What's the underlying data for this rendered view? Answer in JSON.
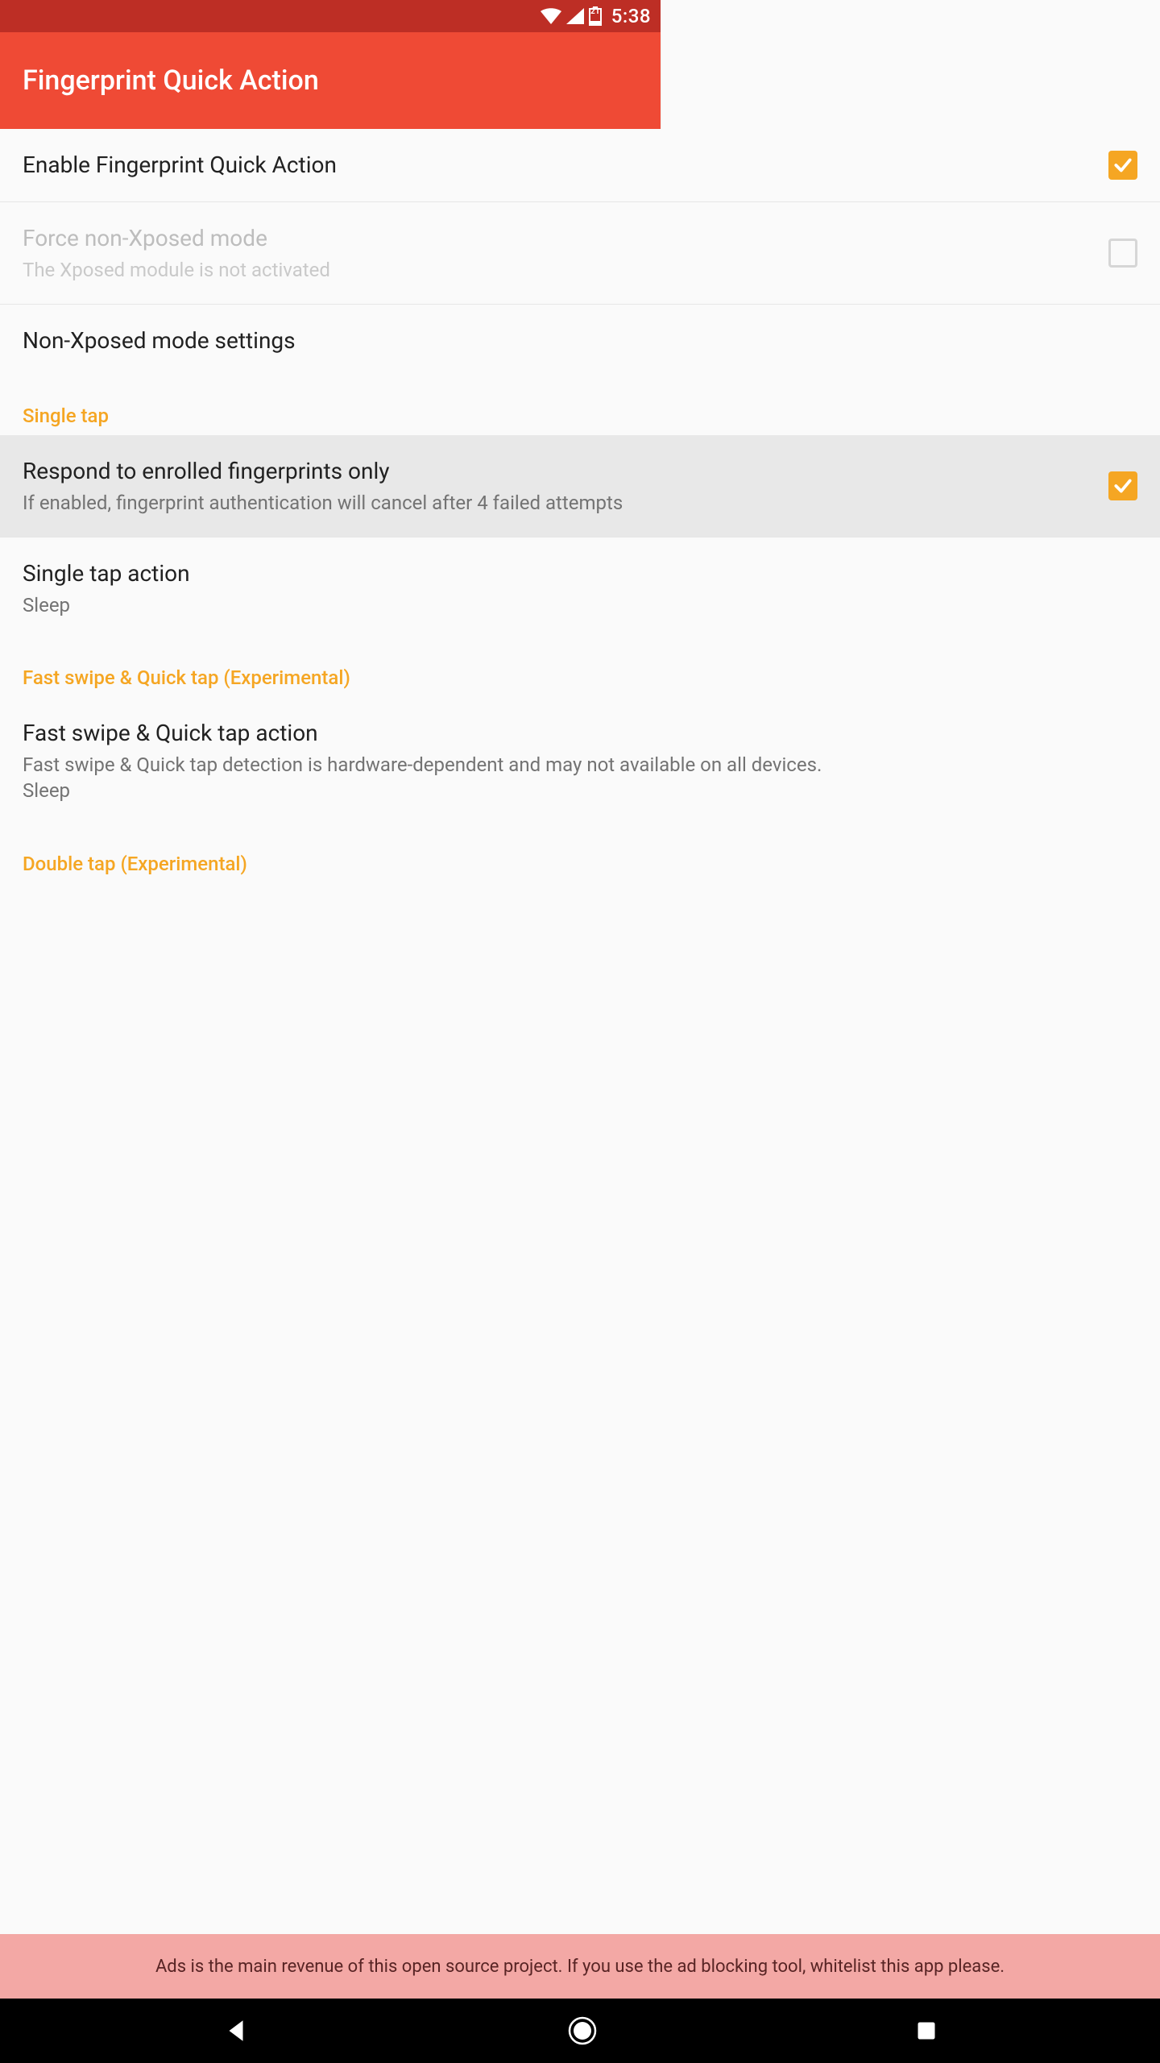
{
  "status": {
    "battery_pct": "21",
    "time": "5:38"
  },
  "appbar": {
    "title": "Fingerprint Quick Action"
  },
  "settings": {
    "enable": {
      "label": "Enable Fingerprint Quick Action"
    },
    "force_non_xposed": {
      "label": "Force non-Xposed mode",
      "sub": "The Xposed module is not activated"
    },
    "non_xposed_settings": {
      "label": "Non-Xposed mode settings"
    }
  },
  "sections": {
    "single_tap": "Single tap",
    "fast_swipe": "Fast swipe & Quick tap (Experimental)",
    "double_tap": "Double tap (Experimental)"
  },
  "single_tap": {
    "respond_enrolled": {
      "label": "Respond to enrolled fingerprints only",
      "sub": "If enabled, fingerprint authentication will cancel after 4 failed attempts"
    },
    "action": {
      "label": "Single tap action",
      "value": "Sleep"
    }
  },
  "fast_swipe": {
    "action": {
      "label": "Fast swipe & Quick tap action",
      "sub": "Fast swipe & Quick tap detection is hardware-dependent and may not available on all devices.",
      "value": "Sleep"
    }
  },
  "ad_banner": "Ads is the main revenue of this open source project. If you use the ad blocking tool, whitelist this app please."
}
